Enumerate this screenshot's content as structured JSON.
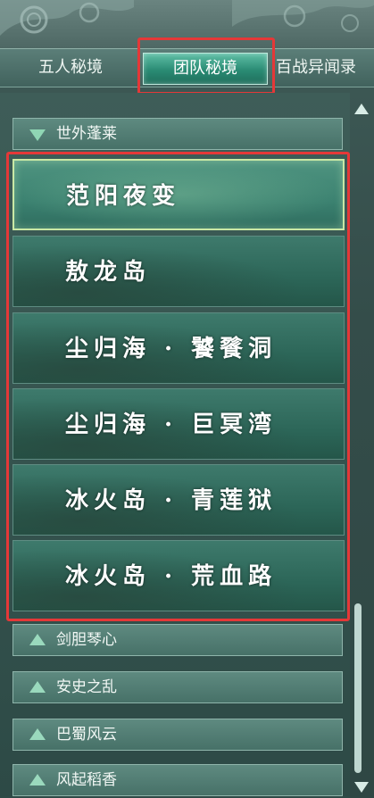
{
  "tabs": [
    {
      "label": "五人秘境",
      "active": false
    },
    {
      "label": "团队秘境",
      "active": true
    },
    {
      "label": "百战异闻录",
      "active": false
    }
  ],
  "category_open": {
    "label": "世外蓬莱",
    "expanded": true
  },
  "dungeons": [
    {
      "name": "范阳夜变",
      "selected": true
    },
    {
      "name": "敖龙岛",
      "selected": false
    },
    {
      "name": "尘归海 · 饕餮洞",
      "selected": false
    },
    {
      "name": "尘归海 · 巨冥湾",
      "selected": false
    },
    {
      "name": "冰火岛 · 青莲狱",
      "selected": false
    },
    {
      "name": "冰火岛 · 荒血路",
      "selected": false
    }
  ],
  "categories_collapsed": [
    {
      "label": "剑胆琴心"
    },
    {
      "label": "安史之乱"
    },
    {
      "label": "巴蜀风云"
    },
    {
      "label": "风起稻香"
    }
  ],
  "colors": {
    "highlight_box": "#e43838",
    "tab_active": "#2a8b74",
    "panel_bg": "#344d4a"
  }
}
